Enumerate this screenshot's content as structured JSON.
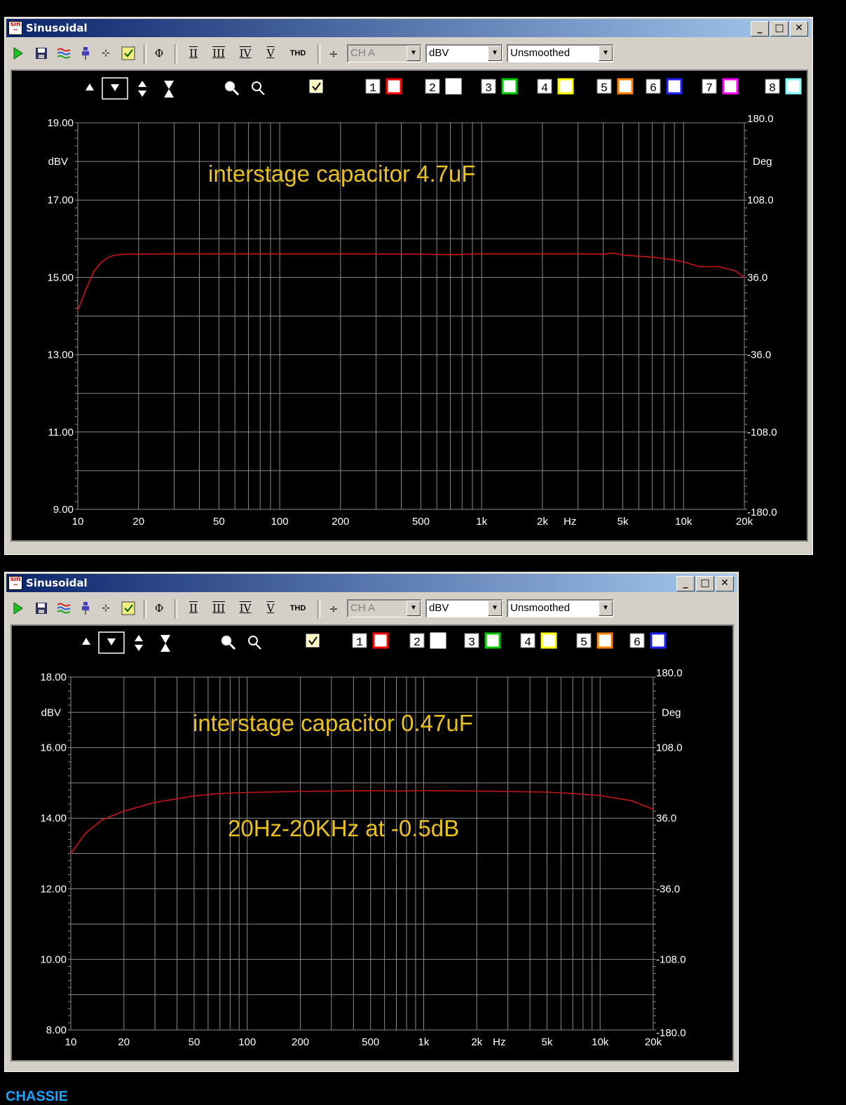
{
  "colors": {
    "trace": "#c81414",
    "annotation": "#e8c020",
    "grid": "#8a8a8a",
    "footer": "#1ea0ff"
  },
  "toolbar": {
    "icons": [
      "play-icon",
      "save-icon",
      "spectrum-icon",
      "probe-icon",
      "generator-icon",
      "checklist-icon"
    ],
    "phi": "Φ",
    "harmonics": [
      "II",
      "III",
      "IV",
      "V"
    ],
    "thd": "THD",
    "channel": "CH A",
    "unit": "dBV",
    "smoothing": "Unsmoothed"
  },
  "windows": [
    {
      "title": "Sinusoidal",
      "overlays": [
        "1",
        "2",
        "3",
        "4",
        "5",
        "6",
        "7",
        "8"
      ],
      "overlay_colors": [
        "#ff0000",
        "#ffffff",
        "#00c800",
        "#ffff00",
        "#ff8000",
        "#2020ff",
        "#ff00ff",
        "#80ffff"
      ],
      "chart_data": {
        "type": "line",
        "x_scale": "log",
        "xlim": [
          10,
          20000
        ],
        "ylim": [
          9,
          19
        ],
        "yticks": [
          {
            "v": 19,
            "l": "19.00"
          },
          {
            "v": 17,
            "l": "17.00"
          },
          {
            "v": 15,
            "l": "15.00"
          },
          {
            "v": 13,
            "l": "13.00"
          },
          {
            "v": 11,
            "l": "11.00"
          },
          {
            "v": 9,
            "l": "9.00"
          }
        ],
        "y2ticks": [
          "180.0",
          "108.0",
          "36.0",
          "-36.0",
          "-108.0",
          "-180.0"
        ],
        "xticks": [
          {
            "v": 10,
            "l": "10"
          },
          {
            "v": 20,
            "l": "20"
          },
          {
            "v": 50,
            "l": "50"
          },
          {
            "v": 100,
            "l": "100"
          },
          {
            "v": 200,
            "l": "200"
          },
          {
            "v": 500,
            "l": "500"
          },
          {
            "v": 1000,
            "l": "1k"
          },
          {
            "v": 2000,
            "l": "2k"
          },
          {
            "v": 5000,
            "l": "5k"
          },
          {
            "v": 10000,
            "l": "10k"
          },
          {
            "v": 20000,
            "l": "20k"
          }
        ],
        "ylabel": "dBV",
        "y2label": "Deg",
        "xunit": "Hz",
        "annotations": [
          "interstage capacitor 4.7uF"
        ],
        "series": [
          {
            "x": [
              10,
              11,
              12,
              13,
              14,
              15,
              17,
              20,
              30,
              50,
              100,
              200,
              500,
              700,
              1000,
              1500,
              2000,
              3000,
              4000,
              4500,
              5000,
              7000,
              8000,
              9000,
              10000,
              12000,
              15000,
              18000,
              20000
            ],
            "y": [
              14.15,
              14.7,
              15.15,
              15.38,
              15.5,
              15.57,
              15.6,
              15.6,
              15.61,
              15.61,
              15.61,
              15.61,
              15.6,
              15.59,
              15.61,
              15.61,
              15.61,
              15.61,
              15.6,
              15.63,
              15.58,
              15.52,
              15.49,
              15.45,
              15.4,
              15.28,
              15.28,
              15.17,
              15.0
            ]
          }
        ]
      }
    },
    {
      "title": "Sinusoidal",
      "overlays": [
        "1",
        "2",
        "3",
        "4",
        "5",
        "6"
      ],
      "overlay_colors": [
        "#ff0000",
        "#ffffff",
        "#00c800",
        "#ffff00",
        "#ff8000",
        "#2020ff"
      ],
      "chart_data": {
        "type": "line",
        "x_scale": "log",
        "xlim": [
          10,
          20000
        ],
        "ylim": [
          8,
          18
        ],
        "yticks": [
          {
            "v": 18,
            "l": "18.00"
          },
          {
            "v": 16,
            "l": "16.00"
          },
          {
            "v": 14,
            "l": "14.00"
          },
          {
            "v": 12,
            "l": "12.00"
          },
          {
            "v": 10,
            "l": "10.00"
          },
          {
            "v": 8,
            "l": "8.00"
          }
        ],
        "y2ticks": [
          "180.0",
          "108.0",
          "36.0",
          "-36.0",
          "-108.0",
          "-180.0"
        ],
        "xticks": [
          {
            "v": 10,
            "l": "10"
          },
          {
            "v": 20,
            "l": "20"
          },
          {
            "v": 50,
            "l": "50"
          },
          {
            "v": 100,
            "l": "100"
          },
          {
            "v": 200,
            "l": "200"
          },
          {
            "v": 500,
            "l": "500"
          },
          {
            "v": 1000,
            "l": "1k"
          },
          {
            "v": 2000,
            "l": "2k"
          },
          {
            "v": 5000,
            "l": "5k"
          },
          {
            "v": 10000,
            "l": "10k"
          },
          {
            "v": 20000,
            "l": "20k"
          }
        ],
        "ylabel": "dBV",
        "y2label": "Deg",
        "xunit": "Hz",
        "annotations": [
          "interstage capacitor 0.47uF",
          "20Hz-20KHz at -0.5dB"
        ],
        "series": [
          {
            "x": [
              10,
              12,
              15,
              20,
              30,
              50,
              70,
              100,
              200,
              500,
              700,
              1000,
              2000,
              5000,
              7000,
              10000,
              15000,
              20000
            ],
            "y": [
              13.0,
              13.55,
              13.95,
              14.2,
              14.45,
              14.63,
              14.7,
              14.73,
              14.76,
              14.78,
              14.77,
              14.78,
              14.77,
              14.74,
              14.7,
              14.64,
              14.5,
              14.25
            ]
          }
        ]
      }
    }
  ],
  "footer": {
    "text": "CHASSIE"
  }
}
